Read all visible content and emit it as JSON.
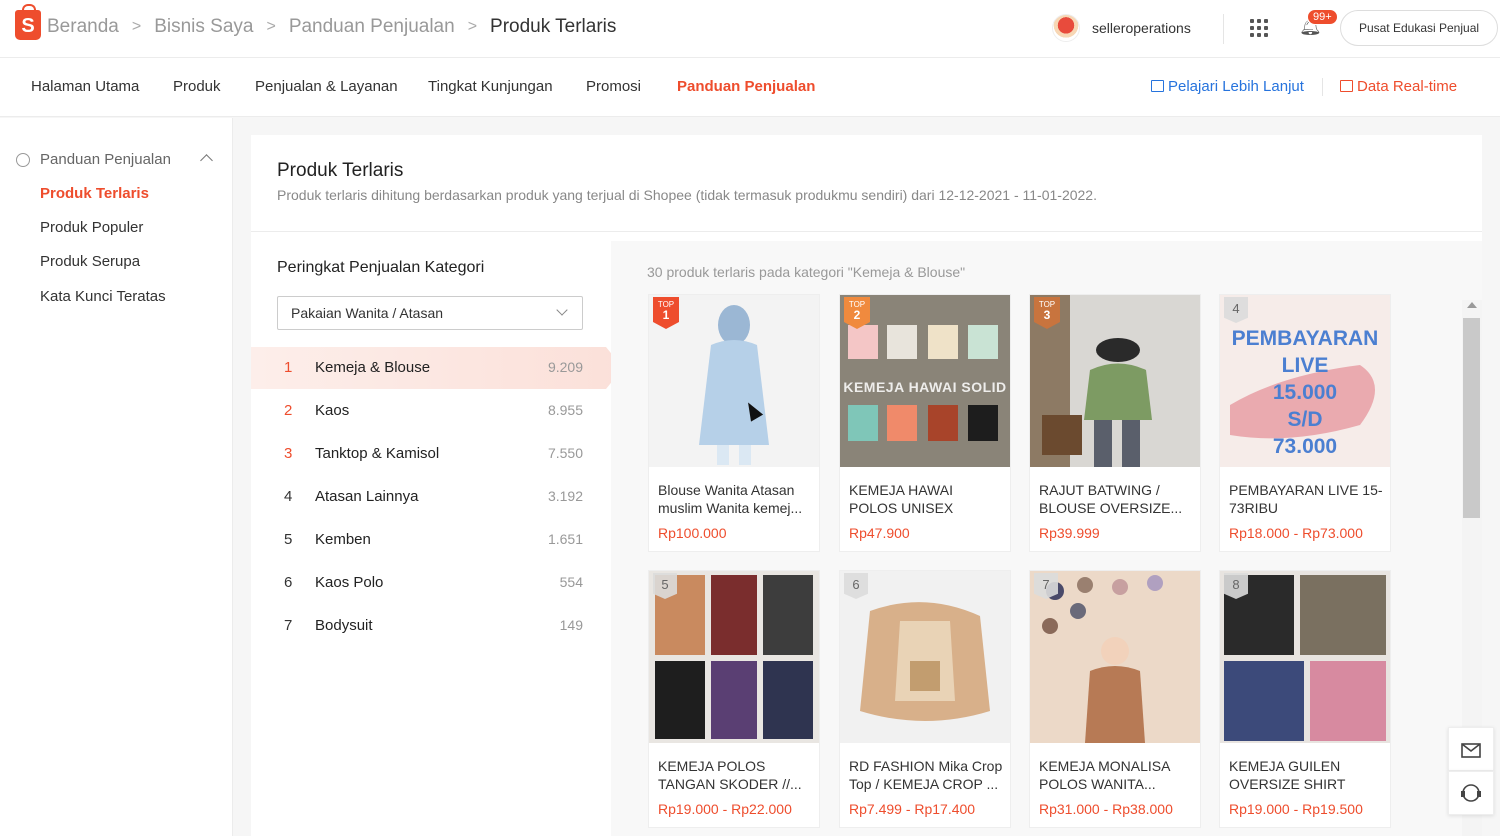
{
  "header": {
    "breadcrumbs": [
      "Beranda",
      "Bisnis Saya",
      "Panduan Penjualan",
      "Produk Terlaris"
    ],
    "username": "selleroperations",
    "notif_count": "99+",
    "edu_button": "Pusat Edukasi Penjual"
  },
  "nav": {
    "tabs": [
      "Halaman Utama",
      "Produk",
      "Penjualan & Layanan",
      "Tingkat Kunjungan",
      "Promosi",
      "Panduan Penjualan"
    ],
    "learn_more": "Pelajari Lebih Lanjut",
    "realtime": "Data Real-time"
  },
  "sidebar": {
    "header": "Panduan Penjualan",
    "items": [
      "Produk Terlaris",
      "Produk Populer",
      "Produk Serupa",
      "Kata Kunci Teratas"
    ]
  },
  "main": {
    "title": "Produk Terlaris",
    "subtitle": "Produk terlaris dihitung berdasarkan produk yang terjual di Shopee (tidak termasuk produkmu sendiri) dari 12-12-2021 - 11-01-2022.",
    "category_title": "Peringkat Penjualan Kategori",
    "category_select": "Pakaian Wanita / Atasan",
    "categories": [
      {
        "rank": "1",
        "name": "Kemeja & Blouse",
        "value": "9.209"
      },
      {
        "rank": "2",
        "name": "Kaos",
        "value": "8.955"
      },
      {
        "rank": "3",
        "name": "Tanktop & Kamisol",
        "value": "7.550"
      },
      {
        "rank": "4",
        "name": "Atasan Lainnya",
        "value": "3.192"
      },
      {
        "rank": "5",
        "name": "Kemben",
        "value": "1.651"
      },
      {
        "rank": "6",
        "name": "Kaos Polo",
        "value": "554"
      },
      {
        "rank": "7",
        "name": "Bodysuit",
        "value": "149"
      }
    ],
    "products_caption": "30 produk terlaris pada kategori \"Kemeja & Blouse\"",
    "top_label": "TOP",
    "products": [
      {
        "rank": "1",
        "name": "Blouse Wanita Atasan muslim Wanita kemej...",
        "price": "Rp100.000"
      },
      {
        "rank": "2",
        "name": "KEMEJA HAWAI POLOS UNISEX KATU...",
        "price": "Rp47.900",
        "image_text": "KEMEJA HAWAI SOLID"
      },
      {
        "rank": "3",
        "name": "RAJUT BATWING / BLOUSE OVERSIZE...",
        "price": "Rp39.999"
      },
      {
        "rank": "4",
        "name": "PEMBAYARAN LIVE 15-73RIBU",
        "price": "Rp18.000 - Rp73.000",
        "image_text": [
          "PEMBAYARAN LIVE",
          "15.000",
          "S/D",
          "73.000"
        ]
      },
      {
        "rank": "5",
        "name": "KEMEJA POLOS TANGAN SKODER //...",
        "price": "Rp19.000 - Rp22.000"
      },
      {
        "rank": "6",
        "name": "RD FASHION Mika Crop Top / KEMEJA CROP ...",
        "price": "Rp7.499 - Rp17.400"
      },
      {
        "rank": "7",
        "name": "KEMEJA MONALISA POLOS WANITA...",
        "price": "Rp31.000 - Rp38.000"
      },
      {
        "rank": "8",
        "name": "KEMEJA GUILEN OVERSIZE SHIRT",
        "price": "Rp19.000 - Rp19.500"
      }
    ]
  },
  "colors": {
    "accent": "#ee4d2d",
    "link": "#2673dd"
  }
}
